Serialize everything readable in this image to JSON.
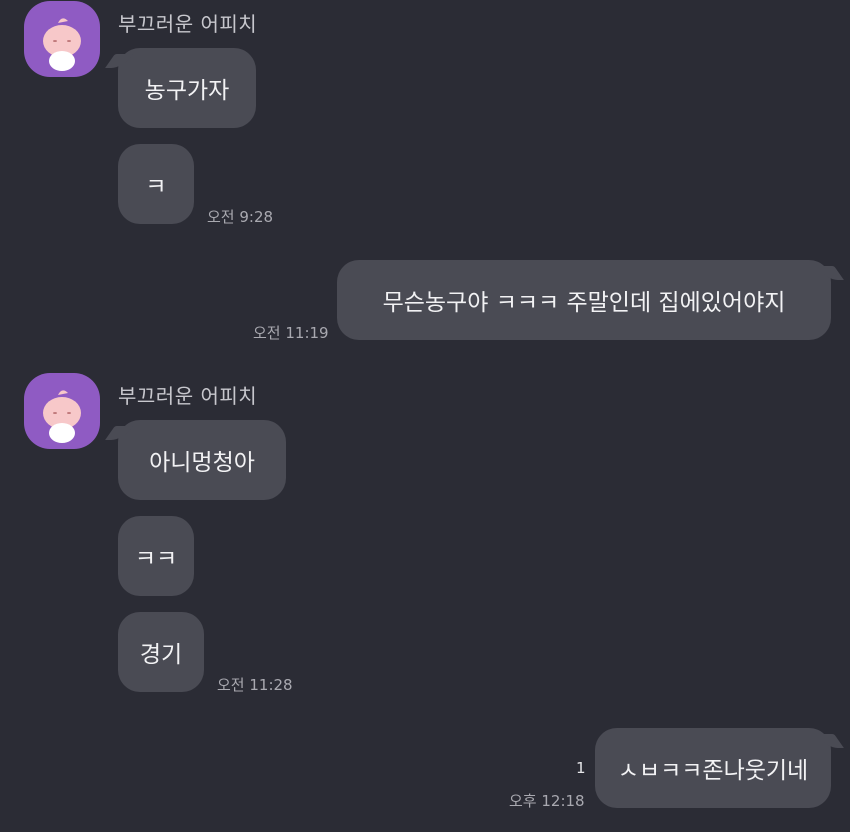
{
  "messages": {
    "group1": {
      "sender": "부끄러운 어피치",
      "bubble1": "농구가자",
      "bubble2": "ㅋ",
      "time": "오전 9:28"
    },
    "mine1": {
      "text": "무슨농구야 ㅋㅋㅋ 주말인데 집에있어야지",
      "time": "오전 11:19"
    },
    "group2": {
      "sender": "부끄러운 어피치",
      "bubble1": "아니멍청아",
      "bubble2": "ㅋㅋ",
      "bubble3": "경기",
      "time": "오전 11:28"
    },
    "mine2": {
      "text": "ㅅㅂㅋㅋ존나웃기네",
      "unread": "1",
      "time": "오후 12:18"
    }
  },
  "colors": {
    "background": "#2b2c35",
    "bubble": "#4a4b54",
    "avatar": "#8f5bc3"
  },
  "icons": {
    "avatar": "apeach-character-icon"
  }
}
